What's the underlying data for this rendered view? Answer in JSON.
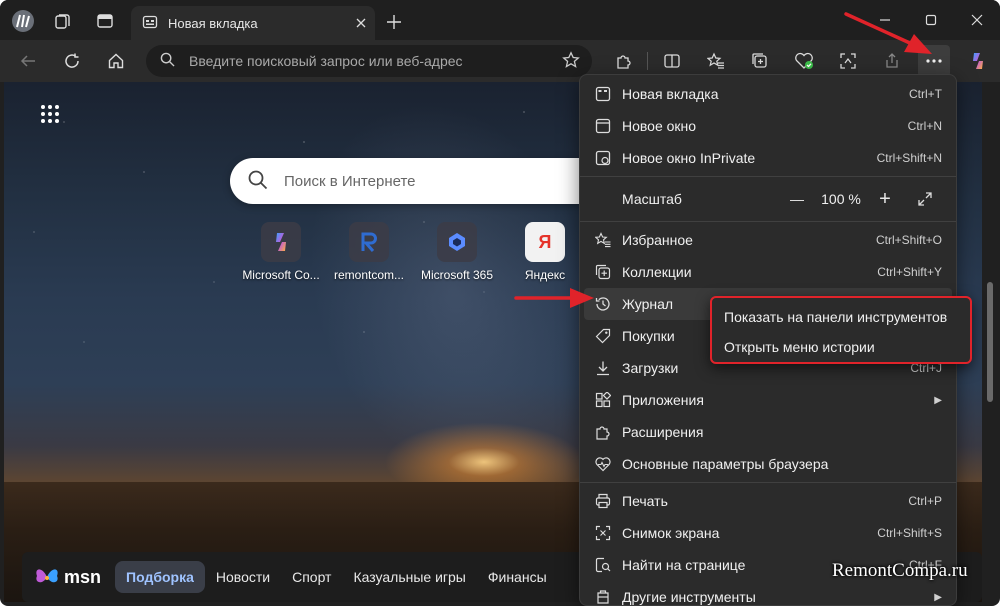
{
  "tab": {
    "title": "Новая вкладка"
  },
  "address_bar": {
    "placeholder": "Введите поисковый запрос или веб-адрес"
  },
  "page": {
    "search_placeholder": "Поиск в Интернете",
    "quicklinks": [
      {
        "label": "Microsoft Co...",
        "color": "#c26ad8"
      },
      {
        "label": "remontcom...",
        "color": "#2f6cd1"
      },
      {
        "label": "Microsoft 365",
        "color": "#5b8cff"
      },
      {
        "label": "Яндекс",
        "color": "#e5332a"
      }
    ],
    "msn": {
      "logo_text": "msn",
      "nav": [
        "Подборка",
        "Новости",
        "Спорт",
        "Казуальные игры",
        "Финансы"
      ]
    }
  },
  "menu": {
    "items": [
      {
        "label": "Новая вкладка",
        "shortcut": "Ctrl+T",
        "icon": "new-tab-icon"
      },
      {
        "label": "Новое окно",
        "shortcut": "Ctrl+N",
        "icon": "new-window-icon"
      },
      {
        "label": "Новое окно InPrivate",
        "shortcut": "Ctrl+Shift+N",
        "icon": "inprivate-icon"
      }
    ],
    "zoom": {
      "label": "Масштаб",
      "minus": "—",
      "value": "100 %",
      "plus": "+"
    },
    "items2": [
      {
        "label": "Избранное",
        "shortcut": "Ctrl+Shift+O",
        "icon": "favorites-icon"
      },
      {
        "label": "Коллекции",
        "shortcut": "Ctrl+Shift+Y",
        "icon": "collections-icon"
      },
      {
        "label": "Журнал",
        "shortcut": "",
        "icon": "history-icon"
      },
      {
        "label": "Покупки",
        "shortcut": "",
        "icon": "shopping-tag-icon"
      },
      {
        "label": "Загрузки",
        "shortcut": "Ctrl+J",
        "icon": "download-icon"
      },
      {
        "label": "Приложения",
        "shortcut": "",
        "icon": "apps-icon"
      },
      {
        "label": "Расширения",
        "shortcut": "",
        "icon": "puzzle-icon"
      },
      {
        "label": "Основные параметры браузера",
        "shortcut": "",
        "icon": "heart-pulse-icon"
      }
    ],
    "items3": [
      {
        "label": "Печать",
        "shortcut": "Ctrl+P",
        "icon": "print-icon"
      },
      {
        "label": "Снимок экрана",
        "shortcut": "Ctrl+Shift+S",
        "icon": "screenshot-icon"
      },
      {
        "label": "Найти на странице",
        "shortcut": "Ctrl+F",
        "icon": "find-icon"
      },
      {
        "label": "Другие инструменты",
        "shortcut": "",
        "icon": "tools-icon"
      }
    ]
  },
  "submenu": {
    "items": [
      "Показать на панели инструментов",
      "Открыть меню истории"
    ]
  },
  "colors": {
    "accent_red": "#e0232a",
    "menu_bg": "#2b2b2b",
    "msn_active": "#9fc3ff"
  },
  "watermark": "RemontCompa.ru"
}
